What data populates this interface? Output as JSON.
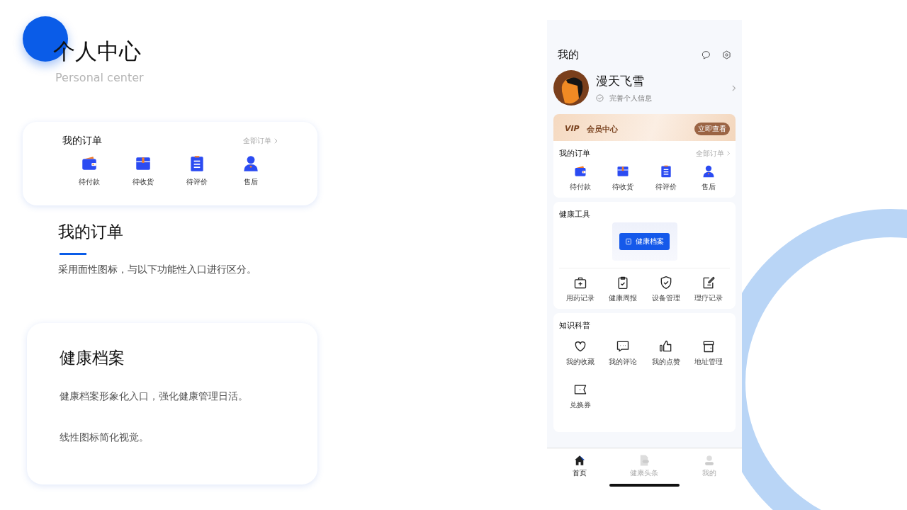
{
  "slide": {
    "title": "个人中心",
    "subtitle": "Personal center"
  },
  "order_card": {
    "title": "我的订单",
    "link": "全部订单",
    "items": [
      {
        "label": "待付款",
        "kind": "wallet"
      },
      {
        "label": "待收货",
        "kind": "box"
      },
      {
        "label": "待评价",
        "kind": "clipboard"
      },
      {
        "label": "售后",
        "kind": "person"
      }
    ]
  },
  "order_note": {
    "heading": "我的订单",
    "text": "采用面性图标，与以下功能性入口进行区分。"
  },
  "health_note": {
    "heading": "健康档案",
    "lines": [
      "健康档案形象化入口，强化健康管理日活。",
      "线性图标简化视觉。"
    ]
  },
  "phone": {
    "title": "我的",
    "user": {
      "name": "漫天飞雪",
      "hint": "完善个人信息"
    },
    "vip": {
      "badge": "VIP",
      "label": "会员中心",
      "button": "立即查看"
    },
    "orders": {
      "title": "我的订单",
      "link": "全部订单",
      "items": [
        {
          "label": "待付款",
          "kind": "wallet"
        },
        {
          "label": "待收货",
          "kind": "box"
        },
        {
          "label": "待评价",
          "kind": "clipboard"
        },
        {
          "label": "售后",
          "kind": "person"
        }
      ]
    },
    "health": {
      "title": "健康工具",
      "button": "健康档案",
      "items": [
        {
          "label": "用药记录",
          "kind": "medkit"
        },
        {
          "label": "健康周报",
          "kind": "report"
        },
        {
          "label": "设备管理",
          "kind": "shield"
        },
        {
          "label": "理疗记录",
          "kind": "edit"
        }
      ]
    },
    "knowledge": {
      "title": "知识科普",
      "items": [
        {
          "label": "我的收藏",
          "kind": "heart"
        },
        {
          "label": "我的评论",
          "kind": "comment"
        },
        {
          "label": "我的点赞",
          "kind": "thumb"
        },
        {
          "label": "地址管理",
          "kind": "store"
        },
        {
          "label": "兑换券",
          "kind": "ticket"
        }
      ]
    },
    "tabs": [
      {
        "label": "首页",
        "kind": "home",
        "selected": true
      },
      {
        "label": "健康头条",
        "kind": "news",
        "selected": false
      },
      {
        "label": "我的",
        "kind": "me",
        "selected": false
      }
    ]
  }
}
